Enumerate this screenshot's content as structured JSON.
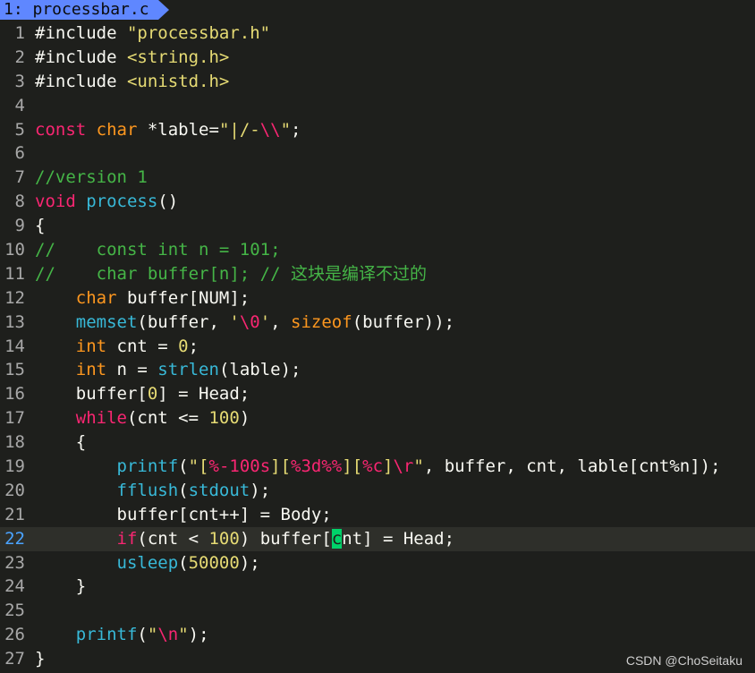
{
  "tab": {
    "label": "1: processbar.c"
  },
  "lines": [
    {
      "n": "1",
      "text": "#include \"processbar.h\""
    },
    {
      "n": "2",
      "text": "#include <string.h>"
    },
    {
      "n": "3",
      "text": "#include <unistd.h>"
    },
    {
      "n": "4",
      "text": ""
    },
    {
      "n": "5",
      "text": "const char *lable=\"|/-\\\\\";"
    },
    {
      "n": "6",
      "text": ""
    },
    {
      "n": "7",
      "text": "//version 1"
    },
    {
      "n": "8",
      "text": "void process()"
    },
    {
      "n": "9",
      "text": "{"
    },
    {
      "n": "10",
      "text": "//    const int n = 101;"
    },
    {
      "n": "11",
      "text": "//    char buffer[n]; // 这块是编译不过的"
    },
    {
      "n": "12",
      "text": "    char buffer[NUM];"
    },
    {
      "n": "13",
      "text": "    memset(buffer, '\\0', sizeof(buffer));"
    },
    {
      "n": "14",
      "text": "    int cnt = 0;"
    },
    {
      "n": "15",
      "text": "    int n = strlen(lable);"
    },
    {
      "n": "16",
      "text": "    buffer[0] = Head;"
    },
    {
      "n": "17",
      "text": "    while(cnt <= 100)"
    },
    {
      "n": "18",
      "text": "    {"
    },
    {
      "n": "19",
      "text": "        printf(\"[%-100s][%3d%%][%c]\\r\", buffer, cnt, lable[cnt%n]);"
    },
    {
      "n": "20",
      "text": "        fflush(stdout);"
    },
    {
      "n": "21",
      "text": "        buffer[cnt++] = Body;"
    },
    {
      "n": "22",
      "text": "        if(cnt < 100) buffer[cnt] = Head;"
    },
    {
      "n": "23",
      "text": "        usleep(50000);"
    },
    {
      "n": "24",
      "text": "    }"
    },
    {
      "n": "25",
      "text": ""
    },
    {
      "n": "26",
      "text": "    printf(\"\\n\");"
    },
    {
      "n": "27",
      "text": "}"
    }
  ],
  "current_line": "22",
  "watermark": "CSDN @ChoSeitaku",
  "colors": {
    "background": "#1e1f1c",
    "tab": "#5f87ff",
    "keyword": "#f92672",
    "type": "#fd971f",
    "function": "#38b9d8",
    "string": "#e6db74",
    "comment": "#45b547",
    "cursor": "#00d26a"
  }
}
